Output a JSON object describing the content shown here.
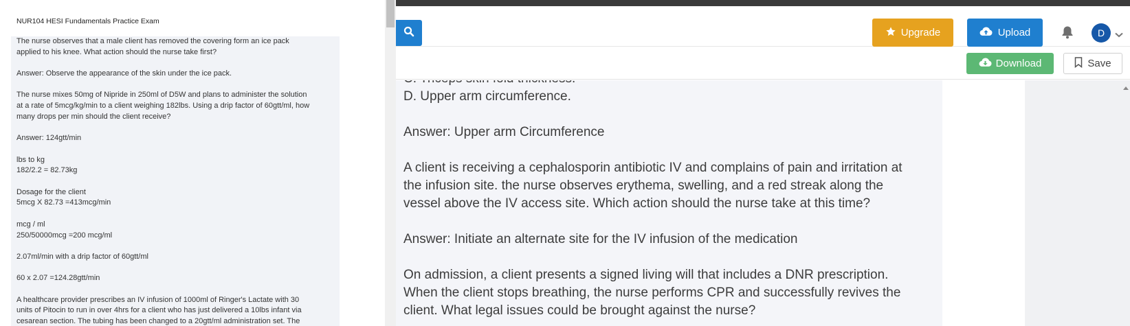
{
  "left_doc": {
    "title": "NUR104 HESI Fundamentals Practice Exam",
    "paragraphs": [
      "The nurse observes that a male client has removed the covering form an ice pack\napplied to his knee. What action should the nurse take first?",
      "Answer: Observe the appearance of the skin under the ice pack.",
      "The nurse mixes 50mg of Nipride in 250ml of D5W and plans to administer the solution\nat a rate of 5mcg/kg/min to a client weighing 182lbs. Using a drip factor of 60gtt/ml, how\nmany drops per min should the client receive?",
      "Answer: 124gtt/min",
      "lbs to kg\n182/2.2 = 82.73kg",
      "Dosage for the client\n5mcg X 82.73 =413mcg/min",
      "mcg / ml\n250/50000mcg =200 mcg/ml",
      "2.07ml/min with a drip factor of 60gtt/ml",
      "60 x 2.07 =124.28gtt/min",
      "A healthcare provider prescribes an IV infusion of 1000ml of Ringer's Lactate with 30\nunits of Pitocin to run in over 4hrs for a client who has just delivered a 10lbs infant via\ncesarean section. The tubing has been changed to a 20gtt/ml administration set. The"
    ]
  },
  "header": {
    "upgrade_label": "Upgrade",
    "upload_label": "Upload",
    "avatar_initial": "D"
  },
  "toolbar": {
    "download_label": "Download",
    "save_label": "Save"
  },
  "document": {
    "paragraphs": [
      "C. Triceps skin fold thickness.\nD. Upper arm circumference.",
      "Answer: Upper arm Circumference",
      "A client is receiving a cephalosporin antibiotic IV and complains of pain and irritation at\nthe infusion site. the nurse observes erythema, swelling, and a red streak along the\nvessel above the IV access site. Which action should the nurse take at this time?",
      "Answer: Initiate an alternate site for the IV infusion of the medication",
      "On admission, a client presents a signed living will that includes a DNR prescription.\nWhen the client stops breathing, the nurse performs CPR and successfully revives the\nclient. What legal issues could be brought against the nurse?"
    ]
  },
  "colors": {
    "primary": "#1f7fcf",
    "upgrade": "#e6a21f",
    "download": "#5cb874",
    "avatar": "#1658a8"
  },
  "icons": [
    "search-icon",
    "star-icon",
    "cloud-upload-icon",
    "bell-icon",
    "chevron-down-icon",
    "cloud-download-icon",
    "bookmark-icon"
  ]
}
